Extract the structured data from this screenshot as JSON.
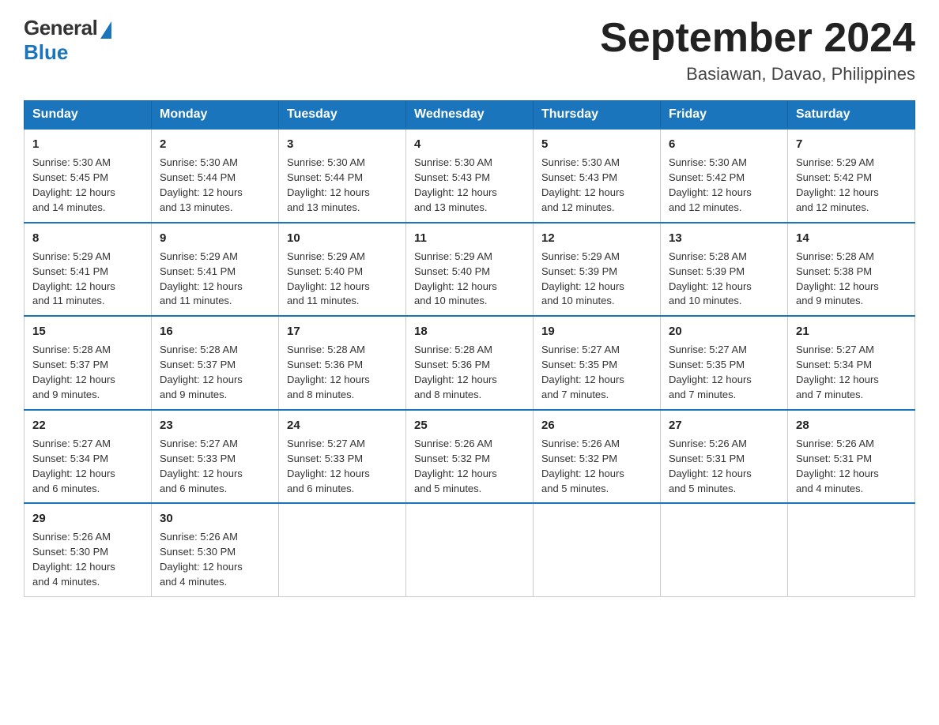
{
  "logo": {
    "general": "General",
    "blue": "Blue"
  },
  "title": "September 2024",
  "subtitle": "Basiawan, Davao, Philippines",
  "weekdays": [
    "Sunday",
    "Monday",
    "Tuesday",
    "Wednesday",
    "Thursday",
    "Friday",
    "Saturday"
  ],
  "weeks": [
    [
      {
        "day": "1",
        "sunrise": "5:30 AM",
        "sunset": "5:45 PM",
        "daylight": "12 hours and 14 minutes."
      },
      {
        "day": "2",
        "sunrise": "5:30 AM",
        "sunset": "5:44 PM",
        "daylight": "12 hours and 13 minutes."
      },
      {
        "day": "3",
        "sunrise": "5:30 AM",
        "sunset": "5:44 PM",
        "daylight": "12 hours and 13 minutes."
      },
      {
        "day": "4",
        "sunrise": "5:30 AM",
        "sunset": "5:43 PM",
        "daylight": "12 hours and 13 minutes."
      },
      {
        "day": "5",
        "sunrise": "5:30 AM",
        "sunset": "5:43 PM",
        "daylight": "12 hours and 12 minutes."
      },
      {
        "day": "6",
        "sunrise": "5:30 AM",
        "sunset": "5:42 PM",
        "daylight": "12 hours and 12 minutes."
      },
      {
        "day": "7",
        "sunrise": "5:29 AM",
        "sunset": "5:42 PM",
        "daylight": "12 hours and 12 minutes."
      }
    ],
    [
      {
        "day": "8",
        "sunrise": "5:29 AM",
        "sunset": "5:41 PM",
        "daylight": "12 hours and 11 minutes."
      },
      {
        "day": "9",
        "sunrise": "5:29 AM",
        "sunset": "5:41 PM",
        "daylight": "12 hours and 11 minutes."
      },
      {
        "day": "10",
        "sunrise": "5:29 AM",
        "sunset": "5:40 PM",
        "daylight": "12 hours and 11 minutes."
      },
      {
        "day": "11",
        "sunrise": "5:29 AM",
        "sunset": "5:40 PM",
        "daylight": "12 hours and 10 minutes."
      },
      {
        "day": "12",
        "sunrise": "5:29 AM",
        "sunset": "5:39 PM",
        "daylight": "12 hours and 10 minutes."
      },
      {
        "day": "13",
        "sunrise": "5:28 AM",
        "sunset": "5:39 PM",
        "daylight": "12 hours and 10 minutes."
      },
      {
        "day": "14",
        "sunrise": "5:28 AM",
        "sunset": "5:38 PM",
        "daylight": "12 hours and 9 minutes."
      }
    ],
    [
      {
        "day": "15",
        "sunrise": "5:28 AM",
        "sunset": "5:37 PM",
        "daylight": "12 hours and 9 minutes."
      },
      {
        "day": "16",
        "sunrise": "5:28 AM",
        "sunset": "5:37 PM",
        "daylight": "12 hours and 9 minutes."
      },
      {
        "day": "17",
        "sunrise": "5:28 AM",
        "sunset": "5:36 PM",
        "daylight": "12 hours and 8 minutes."
      },
      {
        "day": "18",
        "sunrise": "5:28 AM",
        "sunset": "5:36 PM",
        "daylight": "12 hours and 8 minutes."
      },
      {
        "day": "19",
        "sunrise": "5:27 AM",
        "sunset": "5:35 PM",
        "daylight": "12 hours and 7 minutes."
      },
      {
        "day": "20",
        "sunrise": "5:27 AM",
        "sunset": "5:35 PM",
        "daylight": "12 hours and 7 minutes."
      },
      {
        "day": "21",
        "sunrise": "5:27 AM",
        "sunset": "5:34 PM",
        "daylight": "12 hours and 7 minutes."
      }
    ],
    [
      {
        "day": "22",
        "sunrise": "5:27 AM",
        "sunset": "5:34 PM",
        "daylight": "12 hours and 6 minutes."
      },
      {
        "day": "23",
        "sunrise": "5:27 AM",
        "sunset": "5:33 PM",
        "daylight": "12 hours and 6 minutes."
      },
      {
        "day": "24",
        "sunrise": "5:27 AM",
        "sunset": "5:33 PM",
        "daylight": "12 hours and 6 minutes."
      },
      {
        "day": "25",
        "sunrise": "5:26 AM",
        "sunset": "5:32 PM",
        "daylight": "12 hours and 5 minutes."
      },
      {
        "day": "26",
        "sunrise": "5:26 AM",
        "sunset": "5:32 PM",
        "daylight": "12 hours and 5 minutes."
      },
      {
        "day": "27",
        "sunrise": "5:26 AM",
        "sunset": "5:31 PM",
        "daylight": "12 hours and 5 minutes."
      },
      {
        "day": "28",
        "sunrise": "5:26 AM",
        "sunset": "5:31 PM",
        "daylight": "12 hours and 4 minutes."
      }
    ],
    [
      {
        "day": "29",
        "sunrise": "5:26 AM",
        "sunset": "5:30 PM",
        "daylight": "12 hours and 4 minutes."
      },
      {
        "day": "30",
        "sunrise": "5:26 AM",
        "sunset": "5:30 PM",
        "daylight": "12 hours and 4 minutes."
      },
      null,
      null,
      null,
      null,
      null
    ]
  ],
  "labels": {
    "sunrise": "Sunrise:",
    "sunset": "Sunset:",
    "daylight": "Daylight:"
  }
}
